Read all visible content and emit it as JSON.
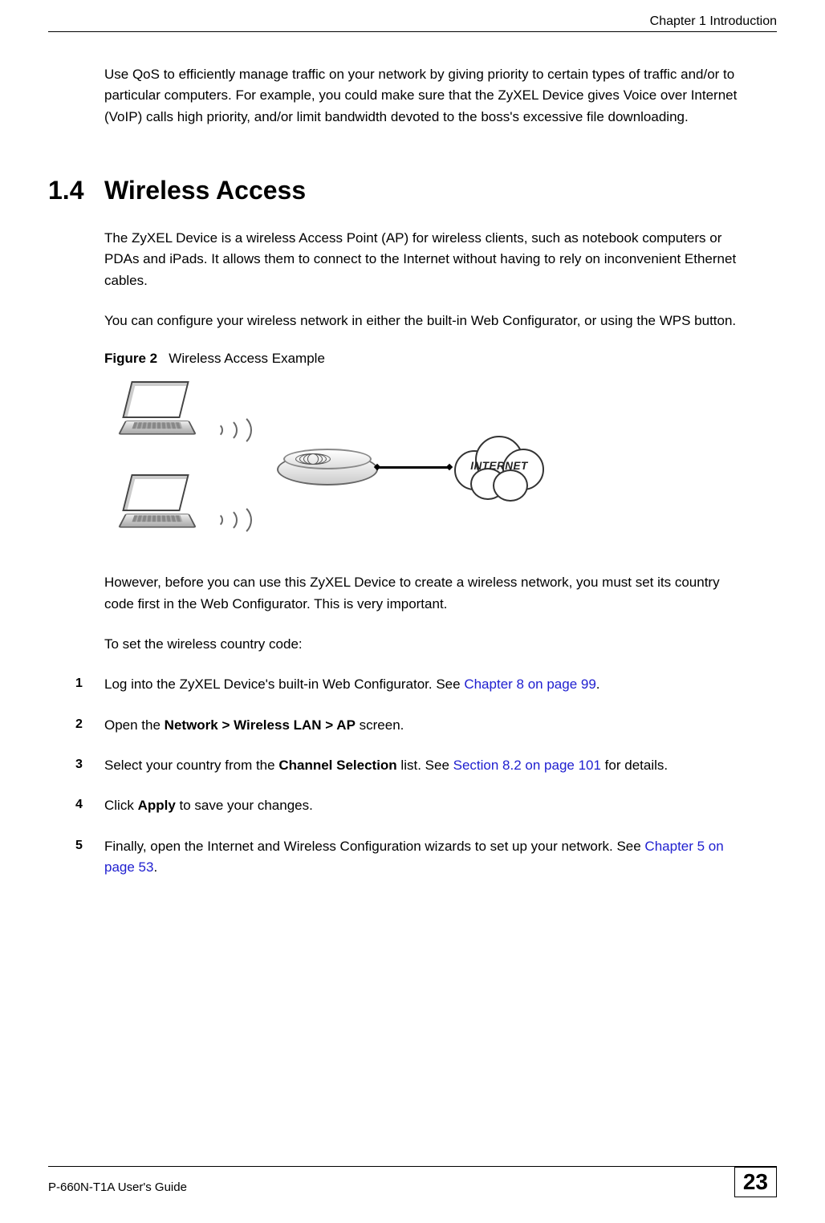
{
  "header": {
    "chapter": "Chapter 1 Introduction"
  },
  "intro": {
    "text": "Use QoS to efficiently manage traffic on your network by giving priority to certain types of traffic and/or to particular computers. For example, you could make sure that the ZyXEL Device gives Voice over Internet (VoIP) calls high priority, and/or limit bandwidth devoted to the boss's excessive file downloading."
  },
  "section": {
    "number": "1.4",
    "title": "Wireless Access",
    "para1": "The ZyXEL Device is a wireless Access Point (AP) for wireless clients, such as notebook computers or PDAs and iPads. It allows them to connect to the Internet without having to rely on inconvenient Ethernet cables.",
    "para2": "You can configure your wireless network in either the built-in Web Configurator, or using the WPS button."
  },
  "figure": {
    "label": "Figure 2",
    "caption": "Wireless Access Example",
    "cloud_label": "INTERNET"
  },
  "after_figure": {
    "para1": "However, before you can use this ZyXEL Device to create a wireless network, you must set its country code first in the Web Configurator. This is very important.",
    "para2": "To set the wireless country code:"
  },
  "steps": [
    {
      "num": "1",
      "before": "Log into the ZyXEL Device's built-in Web Configurator. See ",
      "link": "Chapter 8 on page 99",
      "after": "."
    },
    {
      "num": "2",
      "before": "Open the ",
      "bold": "Network > Wireless LAN > AP",
      "after": " screen."
    },
    {
      "num": "3",
      "before": "Select your country from the ",
      "bold": "Channel Selection",
      "mid": " list. See ",
      "link": "Section 8.2 on page 101",
      "after": " for details."
    },
    {
      "num": "4",
      "before": "Click ",
      "bold": "Apply",
      "after": " to save your changes."
    },
    {
      "num": "5",
      "before": "Finally, open the Internet and Wireless Configuration wizards to set up your network. See ",
      "link": "Chapter 5 on page 53",
      "after": "."
    }
  ],
  "footer": {
    "guide": "P-660N-T1A User's Guide",
    "page": "23"
  }
}
